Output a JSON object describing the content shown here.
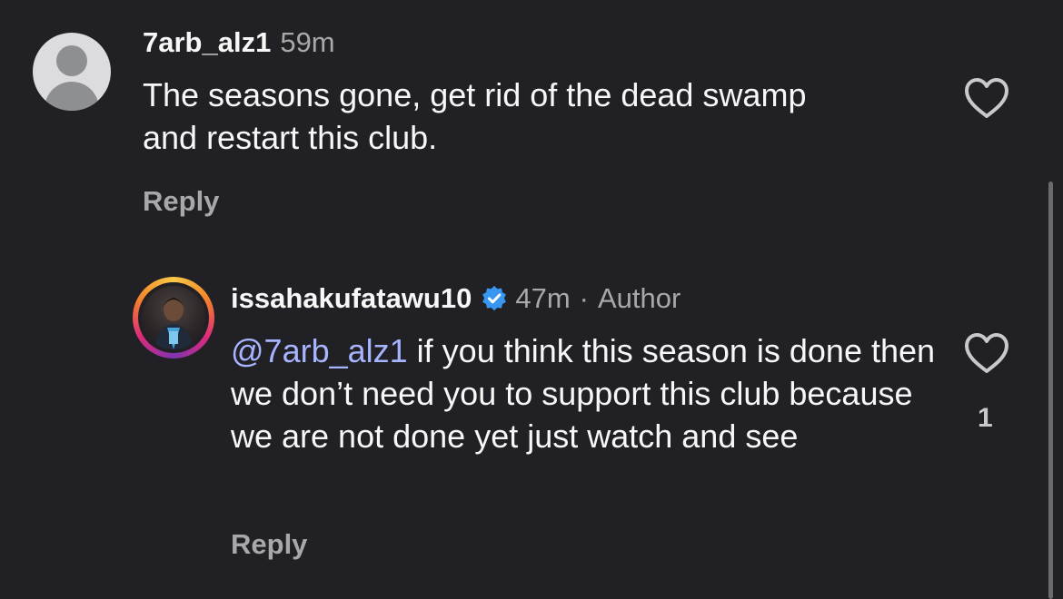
{
  "comment1": {
    "username": "7arb_alz1",
    "time": "59m",
    "text": "The seasons gone, get rid of the dead swamp and restart this club.",
    "reply_label": "Reply"
  },
  "comment2": {
    "username": "issahakufatawu10",
    "time": "47m",
    "separator": "·",
    "author_tag": "Author",
    "mention": "@7arb_alz1",
    "text": " if you think this season is done then we don’t need you to support this club because we are not done yet just watch and see",
    "reply_label": "Reply",
    "like_count": "1"
  },
  "colors": {
    "background": "#212125",
    "mention": "#a7b4ff",
    "verified": "#3797f0",
    "muted": "#a8a8ac"
  },
  "icons": [
    "default-avatar-icon",
    "heart-icon",
    "verified-badge-icon"
  ]
}
